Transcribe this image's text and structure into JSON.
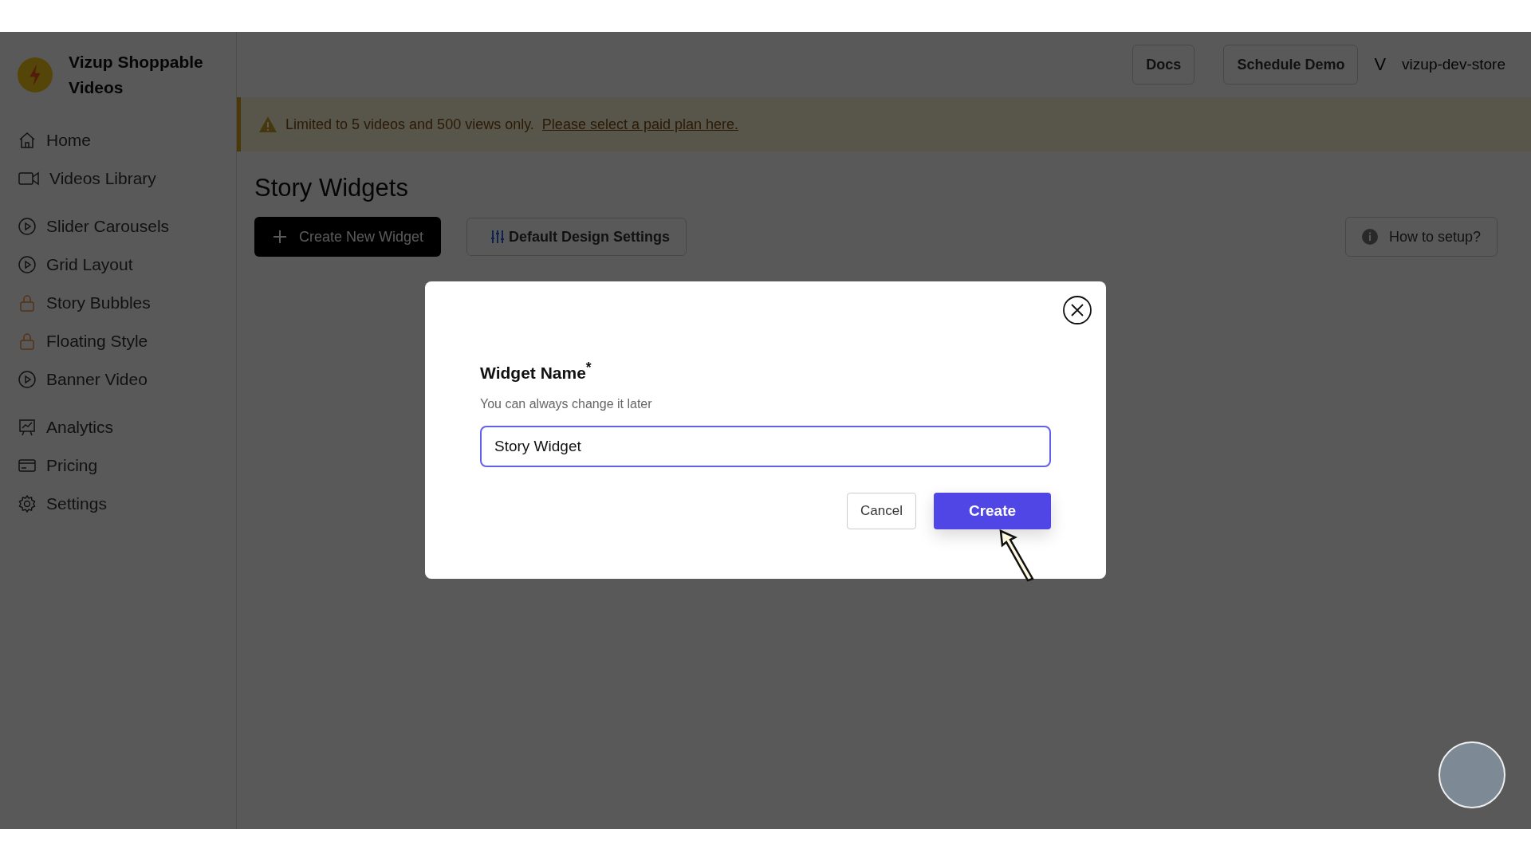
{
  "app": {
    "name": "Vizup Shoppable Videos"
  },
  "nav": [
    {
      "label": "Home",
      "kind": "home"
    },
    {
      "label": "Videos Library",
      "kind": "video"
    },
    {
      "label": "Slider Carousels",
      "kind": "play"
    },
    {
      "label": "Grid Layout",
      "kind": "play"
    },
    {
      "label": "Story Bubbles",
      "kind": "lock"
    },
    {
      "label": "Floating Style",
      "kind": "lock"
    },
    {
      "label": "Banner Video",
      "kind": "play"
    },
    {
      "label": "Analytics",
      "kind": "analytics"
    },
    {
      "label": "Pricing",
      "kind": "card"
    },
    {
      "label": "Settings",
      "kind": "gear"
    }
  ],
  "header": {
    "buttons": [
      "Docs",
      "Schedule Demo"
    ],
    "user": {
      "initial": "V",
      "name": "vizup-dev-store"
    }
  },
  "banner": {
    "text": "Limited to 5 videos and 500 views only.",
    "link": "Please select a paid plan here."
  },
  "page": {
    "title": "Story Widgets",
    "create_button": "Create New Widget",
    "design_button": "Default Design Settings",
    "help_button": "How to setup?"
  },
  "modal": {
    "label": "Widget Name$^{*}$",
    "hint": "You can always change it later",
    "value": "Story Widget",
    "buttons": [
      "Cancel",
      "Create"
    ]
  }
}
